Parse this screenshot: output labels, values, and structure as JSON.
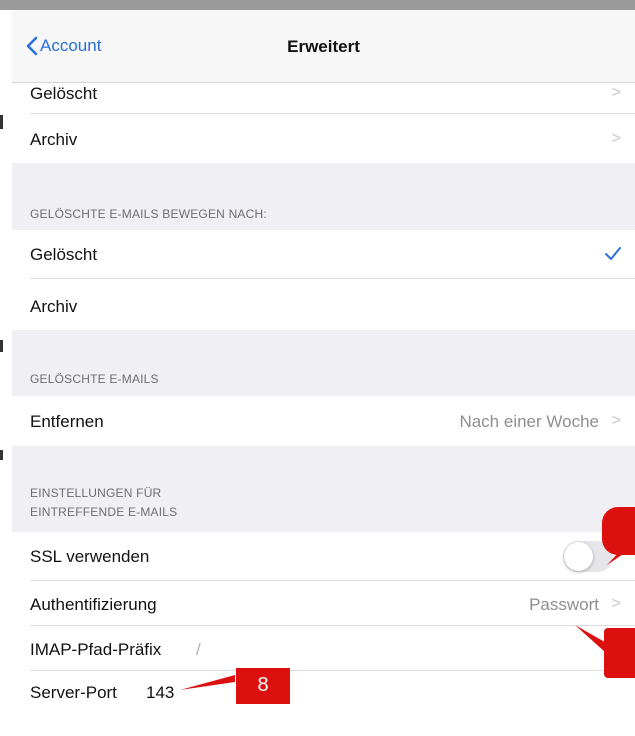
{
  "nav": {
    "back_label": "Account",
    "title": "Erweitert"
  },
  "top_rows": [
    {
      "label": "Gelöscht"
    },
    {
      "label": "Archiv"
    }
  ],
  "section_move": {
    "header": "GELÖSCHTE E-MAILS BEWEGEN NACH:",
    "rows": [
      {
        "label": "Gelöscht",
        "checked": true
      },
      {
        "label": "Archiv",
        "checked": false
      }
    ]
  },
  "section_deleted": {
    "header": "GELÖSCHTE E-MAILS",
    "rows": [
      {
        "label": "Entfernen",
        "value": "Nach einer Woche"
      }
    ]
  },
  "section_incoming": {
    "header_line1": "EINSTELLUNGEN FÜR",
    "header_line2": "EINTREFFENDE E-MAILS",
    "ssl": {
      "label": "SSL verwenden",
      "on": false
    },
    "auth": {
      "label": "Authentifizierung",
      "value": "Passwort"
    },
    "imap": {
      "label": "IMAP-Pfad-Präfix",
      "value": "/"
    },
    "port": {
      "label": "Server-Port",
      "value": "143"
    }
  },
  "annotation": {
    "number": "8"
  },
  "colors": {
    "accent": "#2b6fd7",
    "annotation": "#dd1010",
    "group_bg": "#efeff4"
  }
}
